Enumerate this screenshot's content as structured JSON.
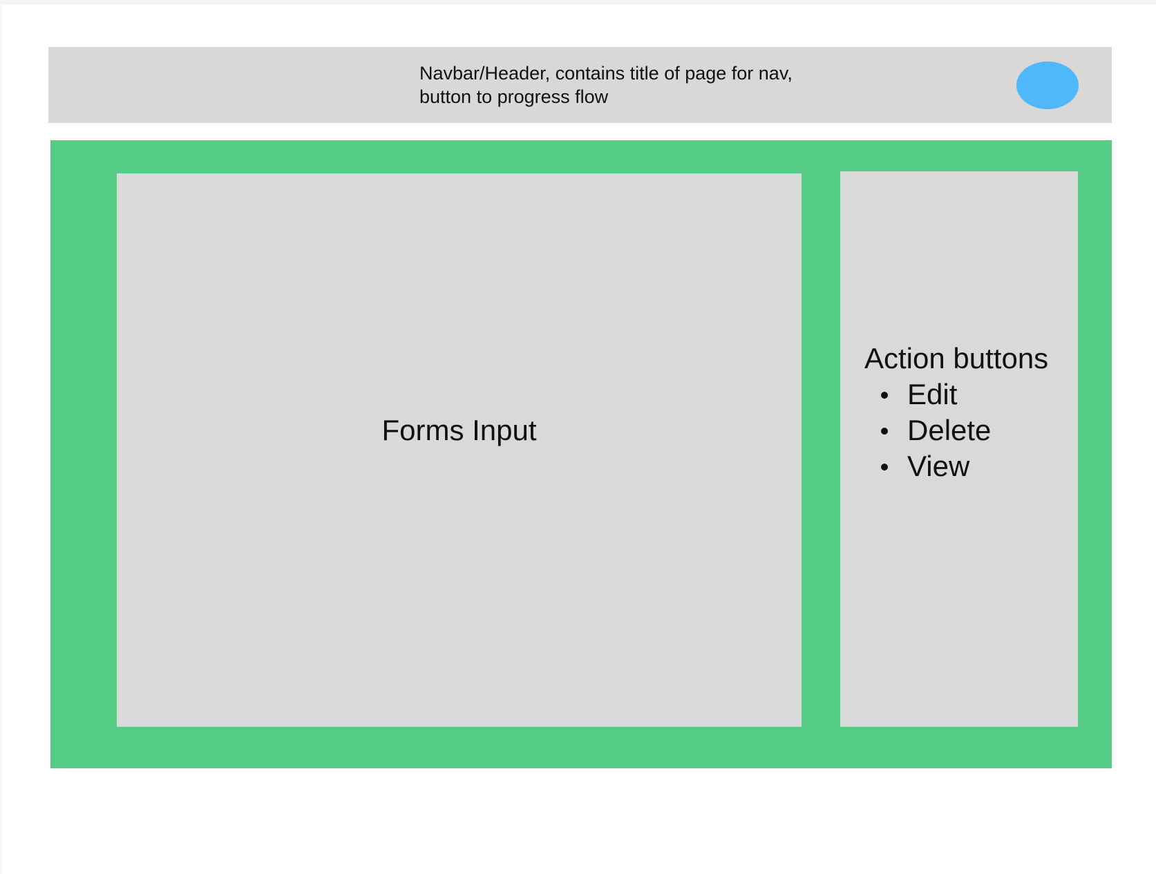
{
  "header": {
    "text": "Navbar/Header, contains title of page for nav, button to progress flow",
    "background_color": "#dad7d7",
    "button_color": "#4fb8fb"
  },
  "main": {
    "background_color": "#56cd86",
    "forms_panel": {
      "label": "Forms Input"
    },
    "actions_panel": {
      "heading": "Action buttons",
      "items": [
        "Edit",
        "Delete",
        "View"
      ]
    }
  }
}
